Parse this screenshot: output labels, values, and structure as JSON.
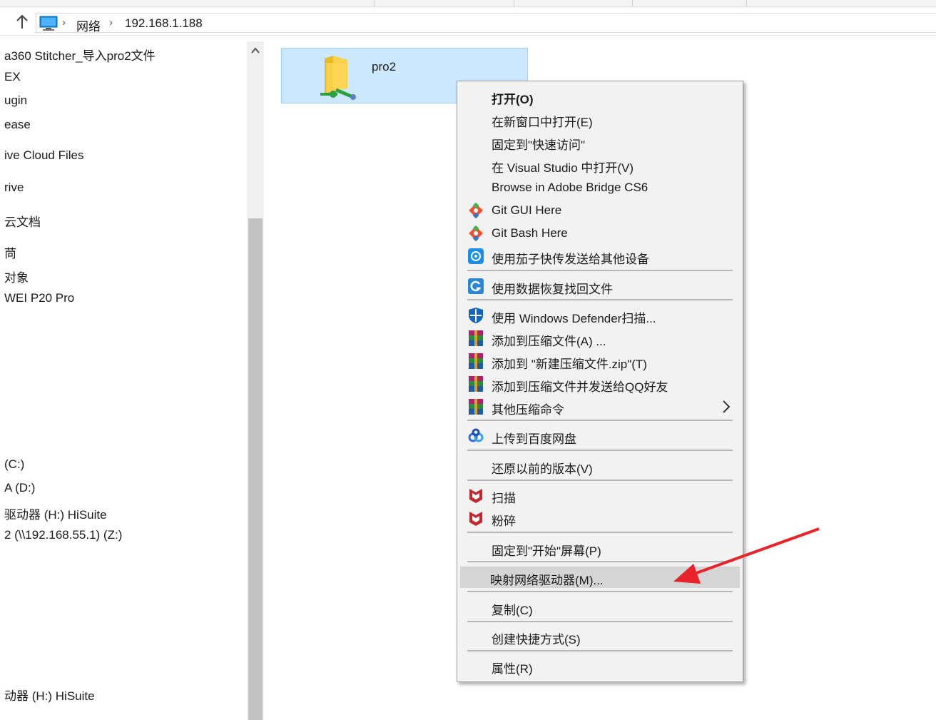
{
  "address_bar": {
    "crumbs": [
      "网络",
      "192.168.1.188"
    ]
  },
  "nav_items": [
    "a360 Stitcher_导入pro2文件",
    "EX",
    "ugin",
    "ease",
    "ive Cloud Files",
    "rive",
    "云文档",
    "苘",
    "对象",
    "WEI P20 Pro",
    "(C:)",
    "A (D:)",
    "驱动器 (H:) HiSuite",
    "2 (\\\\192.168.55.1) (Z:)",
    "动器 (H:) HiSuite"
  ],
  "folder": {
    "name": "pro2"
  },
  "context_menu": {
    "items": [
      {
        "label": "打开(O)",
        "icon": "",
        "bold": true
      },
      {
        "label": "在新窗口中打开(E)",
        "icon": ""
      },
      {
        "label": "固定到\"快速访问\"",
        "icon": ""
      },
      {
        "label": "在 Visual Studio 中打开(V)",
        "icon": ""
      },
      {
        "label": "Browse in Adobe Bridge CS6",
        "icon": ""
      },
      {
        "label": "Git GUI Here",
        "icon": "git-icon"
      },
      {
        "label": "Git Bash Here",
        "icon": "git-icon"
      },
      {
        "label": "使用茄子快传发送给其他设备",
        "icon": "shareit-icon"
      },
      {
        "label": "使用数据恢复找回文件",
        "icon": "recovery-icon"
      },
      {
        "label": "使用 Windows Defender扫描...",
        "icon": "defender-shield-icon"
      },
      {
        "label": "添加到压缩文件(A) ...",
        "icon": "winrar-icon"
      },
      {
        "label": "添加到 \"新建压缩文件.zip\"(T)",
        "icon": "winrar-icon"
      },
      {
        "label": "添加到压缩文件并发送给QQ好友",
        "icon": "winrar-icon"
      },
      {
        "label": "其他压缩命令",
        "icon": "winrar-icon",
        "submenu": true
      },
      {
        "label": "上传到百度网盘",
        "icon": "baidu-netdisk-icon"
      },
      {
        "label": "还原以前的版本(V)",
        "icon": ""
      },
      {
        "label": "扫描",
        "icon": "mcafee-icon"
      },
      {
        "label": "粉碎",
        "icon": "mcafee-icon"
      },
      {
        "label": "固定到\"开始\"屏幕(P)",
        "icon": ""
      },
      {
        "label": "映射网络驱动器(M)...",
        "icon": "",
        "highlighted": true
      },
      {
        "label": "复制(C)",
        "icon": ""
      },
      {
        "label": "创建快捷方式(S)",
        "icon": ""
      },
      {
        "label": "属性(R)",
        "icon": ""
      }
    ]
  },
  "colors": {
    "selection_fill": "#cce8ff",
    "selection_border": "#99d1ff",
    "menu_background": "#f2f2f2",
    "menu_highlight": "#d5d5d5",
    "annotation_arrow": "#e8232a"
  }
}
